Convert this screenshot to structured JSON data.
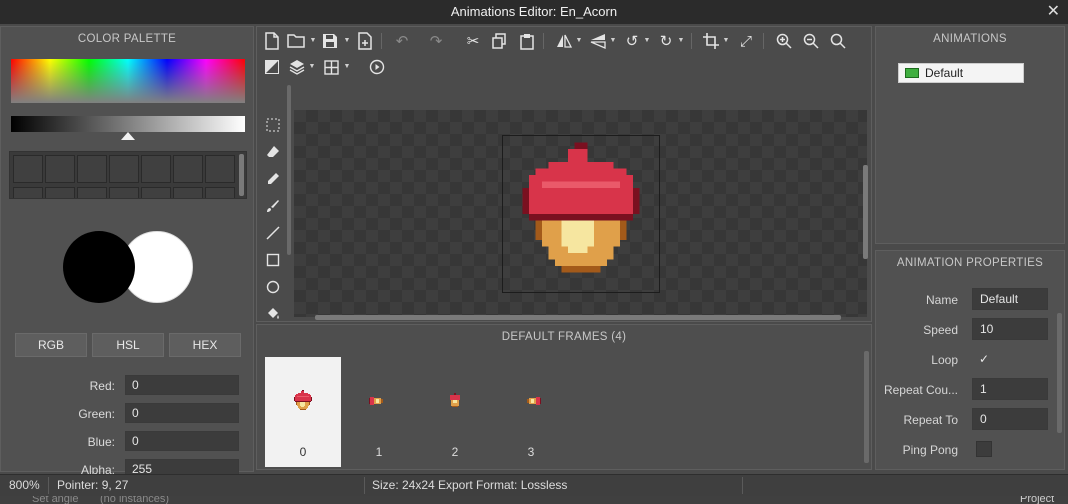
{
  "window": {
    "title": "Animations Editor: En_Acorn",
    "close_glyph": "✕"
  },
  "color_palette": {
    "title": "COLOR PALETTE",
    "primary_color": "#000000",
    "secondary_color": "#ffffff",
    "format_buttons": [
      "RGB",
      "HSL",
      "HEX"
    ],
    "fields": [
      {
        "label": "Red:",
        "value": "0"
      },
      {
        "label": "Green:",
        "value": "0"
      },
      {
        "label": "Blue:",
        "value": "0"
      },
      {
        "label": "Alpha:",
        "value": "255"
      }
    ]
  },
  "toolbar": {
    "row1": [
      "new-file-icon",
      "open-folder-icon",
      "save-icon",
      "export-icon",
      "undo-icon",
      "redo-icon",
      "cut-icon",
      "copy-icon",
      "paste-icon",
      "flip-horizontal-icon",
      "flip-vertical-icon",
      "rotate-left-icon",
      "rotate-right-icon",
      "crop-icon",
      "resize-icon",
      "zoom-in-icon",
      "zoom-out-icon",
      "zoom-fit-icon"
    ],
    "row2": [
      "color-fill-mode-icon",
      "layers-icon",
      "grid-icon",
      "play-icon"
    ]
  },
  "tools": [
    "rectangle-select-icon",
    "eraser-icon",
    "pencil-icon",
    "brush-icon",
    "line-icon",
    "rectangle-icon",
    "ellipse-icon",
    "fill-bucket-icon"
  ],
  "frames": {
    "title": "DEFAULT FRAMES (4)",
    "selected_index": 0,
    "items": [
      {
        "index": "0"
      },
      {
        "index": "1"
      },
      {
        "index": "2"
      },
      {
        "index": "3"
      }
    ]
  },
  "animations": {
    "title": "ANIMATIONS",
    "items": [
      {
        "name": "Default"
      }
    ]
  },
  "properties": {
    "title": "ANIMATION PROPERTIES",
    "name_label": "Name",
    "name_value": "Default",
    "speed_label": "Speed",
    "speed_value": "10",
    "loop_label": "Loop",
    "loop_checked": true,
    "repeat_count_label": "Repeat Cou...",
    "repeat_count_value": "1",
    "repeat_to_label": "Repeat To",
    "repeat_to_value": "0",
    "ping_pong_label": "Ping Pong",
    "ping_pong_checked": false
  },
  "status": {
    "zoom": "800%",
    "pointer": "Pointer: 9, 27",
    "size": "Size: 24x24",
    "export_format": "Export Format: Lossless"
  },
  "background_strip": {
    "left_text": "Set angle",
    "mid_text": "(no instances)",
    "right_text": "Project"
  },
  "colors": {
    "acorn_cap": "#d8344a",
    "acorn_cap_dark": "#7a1020",
    "acorn_body": "#e0a04a",
    "acorn_highlight": "#f6e6a0",
    "acorn_shadow": "#a35a1a"
  }
}
